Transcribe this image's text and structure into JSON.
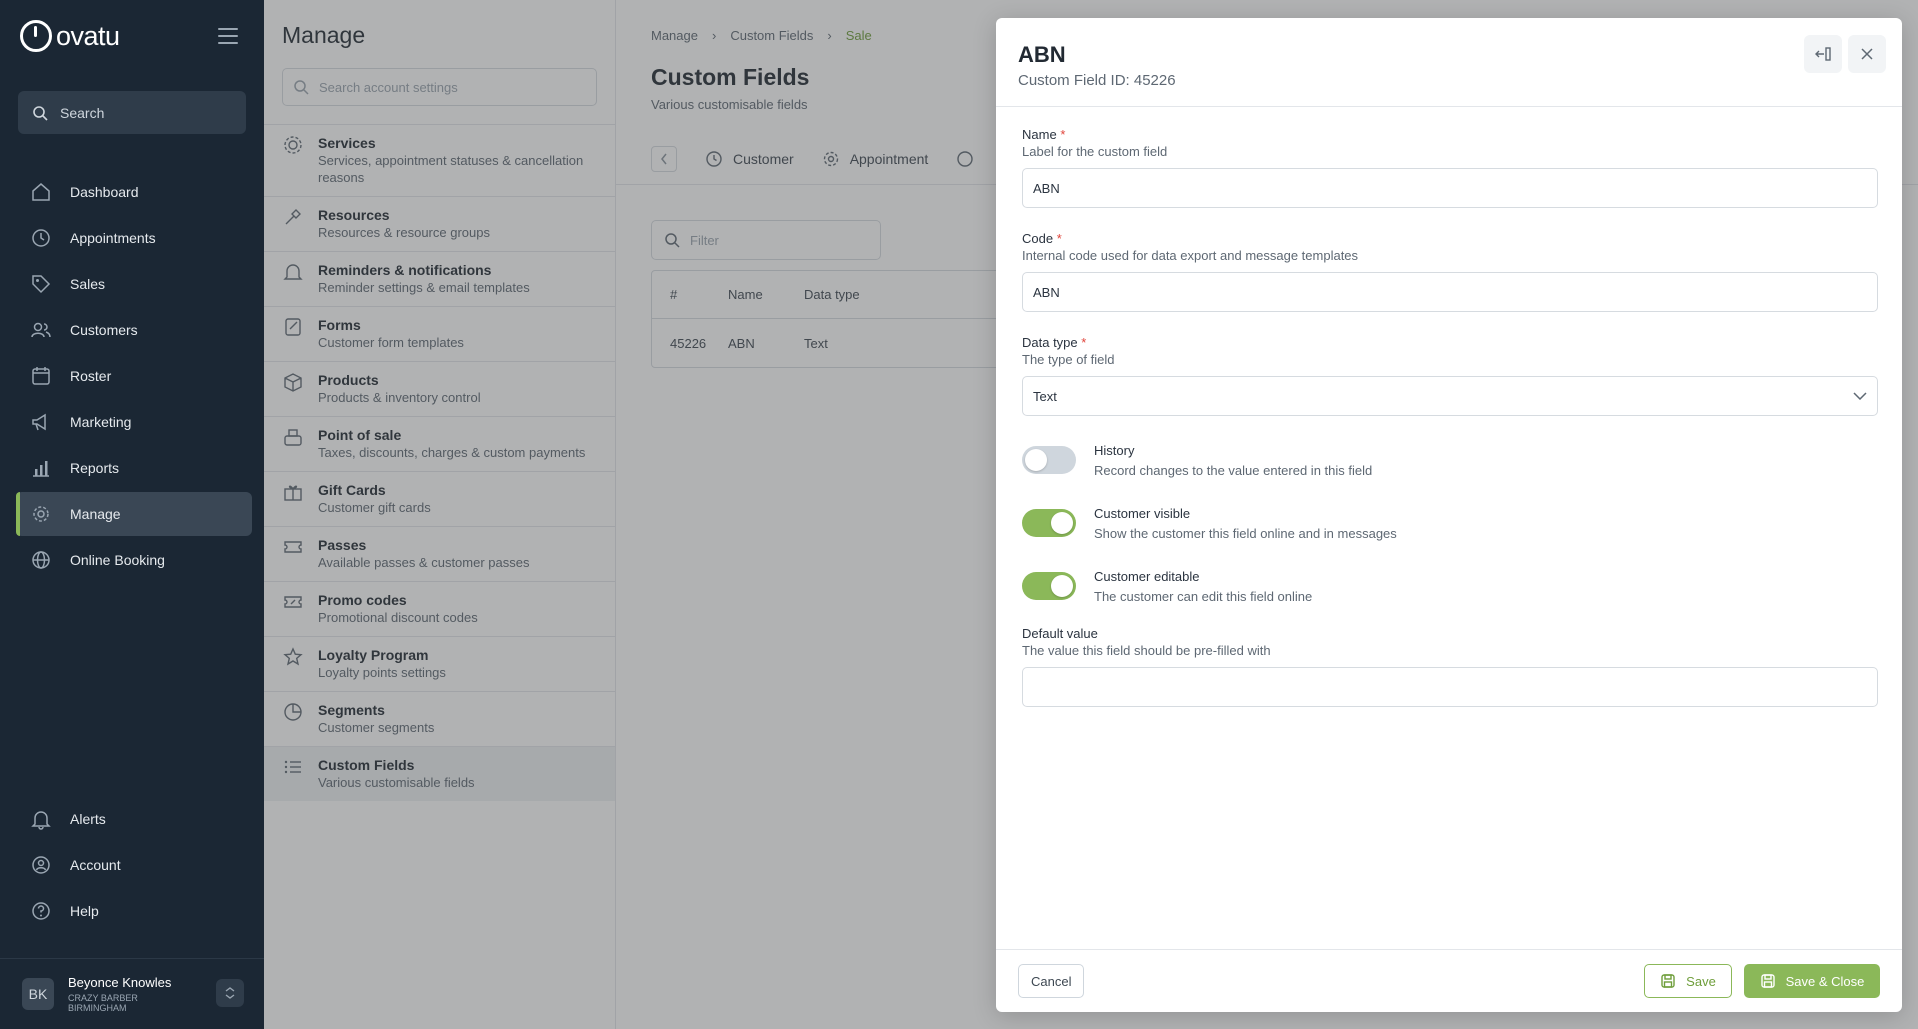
{
  "brand": {
    "name": "ovatu"
  },
  "sidebar": {
    "search_label": "Search",
    "items": [
      {
        "label": "Dashboard",
        "icon": "home-icon"
      },
      {
        "label": "Appointments",
        "icon": "clock-icon"
      },
      {
        "label": "Sales",
        "icon": "tag-icon"
      },
      {
        "label": "Customers",
        "icon": "users-icon"
      },
      {
        "label": "Roster",
        "icon": "calendar-icon"
      },
      {
        "label": "Marketing",
        "icon": "megaphone-icon"
      },
      {
        "label": "Reports",
        "icon": "chart-icon"
      },
      {
        "label": "Manage",
        "icon": "gear-icon",
        "active": true
      },
      {
        "label": "Online Booking",
        "icon": "globe-icon"
      }
    ],
    "bottom_items": [
      {
        "label": "Alerts",
        "icon": "bell-icon"
      },
      {
        "label": "Account",
        "icon": "account-icon"
      },
      {
        "label": "Help",
        "icon": "help-icon"
      }
    ],
    "user": {
      "initials": "BK",
      "name": "Beyonce Knowles",
      "business_line1": "CRAZY BARBER",
      "business_line2": "BIRMINGHAM"
    }
  },
  "manage": {
    "title": "Manage",
    "search_placeholder": "Search account settings",
    "items": [
      {
        "title": "Services",
        "subtitle": "Services, appointment statuses & cancellation reasons"
      },
      {
        "title": "Resources",
        "subtitle": "Resources & resource groups"
      },
      {
        "title": "Reminders & notifications",
        "subtitle": "Reminder settings & email templates"
      },
      {
        "title": "Forms",
        "subtitle": "Customer form templates"
      },
      {
        "title": "Products",
        "subtitle": "Products & inventory control"
      },
      {
        "title": "Point of sale",
        "subtitle": "Taxes, discounts, charges & custom payments"
      },
      {
        "title": "Gift Cards",
        "subtitle": "Customer gift cards"
      },
      {
        "title": "Passes",
        "subtitle": "Available passes & customer passes"
      },
      {
        "title": "Promo codes",
        "subtitle": "Promotional discount codes"
      },
      {
        "title": "Loyalty Program",
        "subtitle": "Loyalty points settings"
      },
      {
        "title": "Segments",
        "subtitle": "Customer segments"
      },
      {
        "title": "Custom Fields",
        "subtitle": "Various customisable fields",
        "active": true
      }
    ]
  },
  "content": {
    "breadcrumb": [
      "Manage",
      "Custom Fields",
      "Sale"
    ],
    "title": "Custom Fields",
    "subtitle": "Various customisable fields",
    "tabs": [
      "Customer",
      "Appointment"
    ],
    "filter_placeholder": "Filter",
    "table": {
      "headers": [
        "#",
        "Name",
        "Data type"
      ],
      "rows": [
        [
          "45226",
          "ABN",
          "Text"
        ]
      ]
    }
  },
  "drawer": {
    "title": "ABN",
    "subtitle": "Custom Field ID: 45226",
    "name": {
      "label": "Name",
      "help": "Label for the custom field",
      "value": "ABN"
    },
    "code": {
      "label": "Code",
      "help": "Internal code used for data export and message templates",
      "value": "ABN"
    },
    "data_type": {
      "label": "Data type",
      "help": "The type of field",
      "value": "Text"
    },
    "toggles": [
      {
        "title": "History",
        "description": "Record changes to the value entered in this field",
        "on": false
      },
      {
        "title": "Customer visible",
        "description": "Show the customer this field online and in messages",
        "on": true
      },
      {
        "title": "Customer editable",
        "description": "The customer can edit this field online",
        "on": true
      }
    ],
    "default_value": {
      "label": "Default value",
      "help": "The value this field should be pre-filled with",
      "value": ""
    },
    "required_mark": "*",
    "buttons": {
      "cancel": "Cancel",
      "save": "Save",
      "save_close": "Save & Close"
    }
  },
  "colors": {
    "accent": "#8bb859",
    "sidebar_bg": "#1b2734",
    "required": "#e0443b"
  }
}
